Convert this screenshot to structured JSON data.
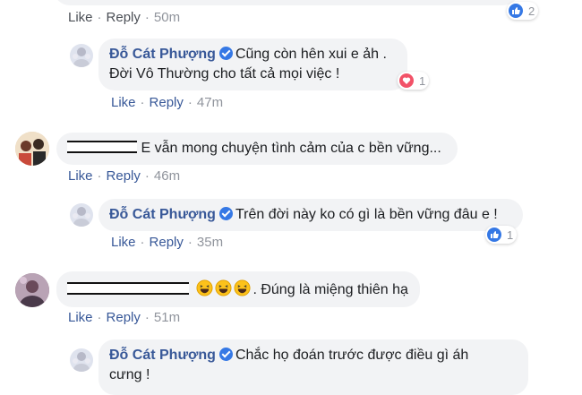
{
  "thread": {
    "c1": {
      "like": "Like",
      "reply": "Reply",
      "time": "50m",
      "reaction_count": "2"
    },
    "r1": {
      "author": "Đỗ Cát Phượng",
      "text_line1": "Cũng còn hên xui e ảh .",
      "text_line2": "Đời Vô Thường cho tất cả mọi việc !",
      "reaction_count": "1",
      "like": "Like",
      "reply": "Reply",
      "time": "47m"
    },
    "c2": {
      "text": "E vẫn mong chuyện tình cảm của c bền vững...",
      "like": "Like",
      "reply": "Reply",
      "time": "46m"
    },
    "r2": {
      "author": "Đỗ Cát Phượng",
      "text": "Trên đời này ko có gì là bền vững đâu e !",
      "reaction_count": "1",
      "like": "Like",
      "reply": "Reply",
      "time": "35m"
    },
    "c3": {
      "text": ". Đúng là miệng thiên hạ",
      "like": "Like",
      "reply": "Reply",
      "time": "51m"
    },
    "r3": {
      "author": "Đỗ Cát Phượng",
      "text_line1": "Chắc họ đoán trước được điều gì áh",
      "text_line2": "cưng !"
    }
  },
  "colors": {
    "link": "#385898",
    "meta": "#90949c",
    "bubble": "#f2f3f5",
    "like_blue": "#3578e5",
    "love_red": "#f25268"
  },
  "icons": [
    "verified-icon",
    "like-reaction-icon",
    "love-reaction-icon",
    "laughing-emoji-icon"
  ]
}
